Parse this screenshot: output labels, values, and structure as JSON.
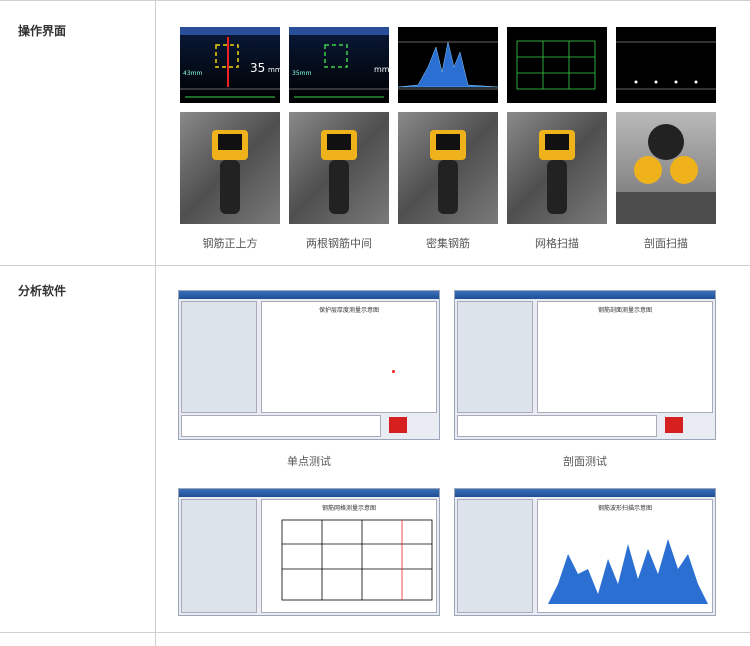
{
  "sections": {
    "operation": {
      "label": "操作界面",
      "captions": [
        "钢筋正上方",
        "两根钢筋中间",
        "密集钢筋",
        "网格扫描",
        "剖面扫描"
      ],
      "screen1": {
        "value": "35",
        "unit": "mm",
        "depth": "43mm"
      },
      "screen2": {
        "value": "",
        "unit": "mm",
        "depth": "35mm"
      }
    },
    "analysis": {
      "label": "分析软件",
      "captions": [
        "单点测试",
        "剖面测试"
      ],
      "windows": {
        "single": {
          "title": "保护层厚度测量示意图"
        },
        "profile": {
          "title": "钢筋剖面测量示意图"
        },
        "grid": {
          "title": "钢筋网格测量示意图"
        },
        "wave": {
          "title": "钢筋波形扫描示意图"
        }
      }
    }
  },
  "colors": {
    "line": "#cfcfcf",
    "screen_bg": "#000000",
    "accent_green": "#3bd14b",
    "accent_yellow": "#f2d20d",
    "chart_blue": "#2a6fd1"
  }
}
